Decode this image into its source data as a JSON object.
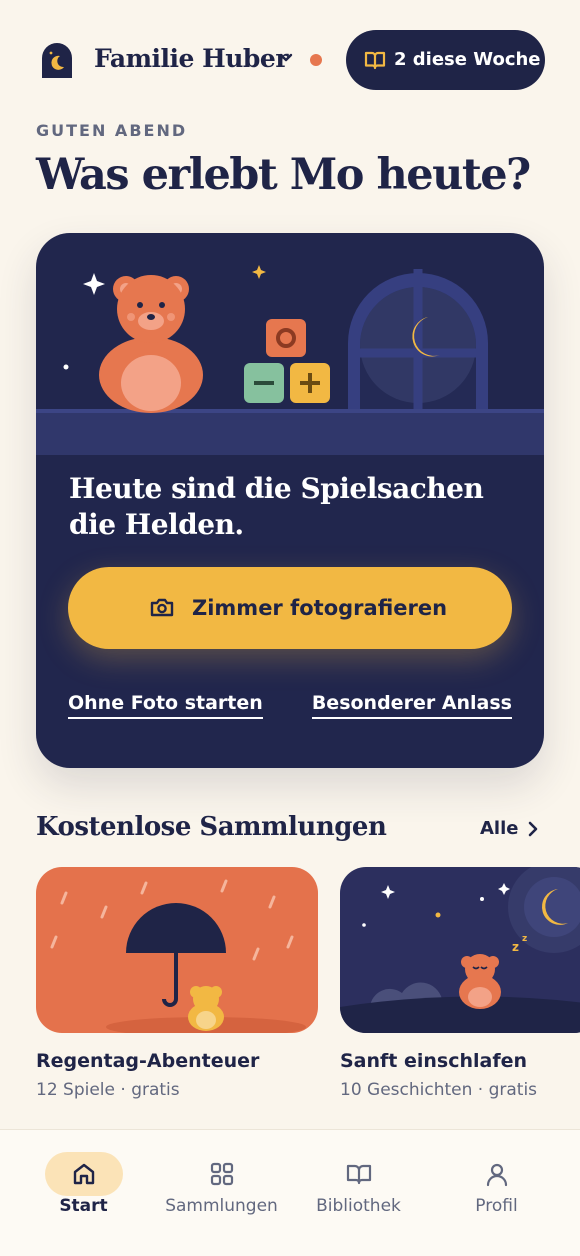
{
  "header": {
    "family_name": "Familie Huber",
    "icons": [
      "family-moon-icon",
      "chevron-down-icon",
      "notification-dot",
      "book-icon"
    ],
    "week_badge": "2 diese Woche"
  },
  "greeting": "GUTEN ABEND",
  "headline": "Was erlebt Mo heute?",
  "hero": {
    "text": "Heute sind die Spielsachen die Helden.",
    "primary_button": "Zimmer fotografieren",
    "link_left": "Ohne Foto starten",
    "link_right": "Besonderer Anlass"
  },
  "collections": {
    "title": "Kostenlose Sammlungen",
    "all_label": "Alle",
    "items": [
      {
        "title": "Regentag-Abenteuer",
        "subtitle": "12 Spiele · gratis"
      },
      {
        "title": "Sanft einschlafen",
        "subtitle": "10 Geschichten · gratis"
      }
    ]
  },
  "tabs": [
    {
      "label": "Start",
      "icon": "home-icon",
      "active": true
    },
    {
      "label": "Sammlungen",
      "icon": "grid-icon",
      "active": false
    },
    {
      "label": "Bibliothek",
      "icon": "book-icon",
      "active": false
    },
    {
      "label": "Profil",
      "icon": "user-icon",
      "active": false
    }
  ],
  "colors": {
    "background": "#faf5ec",
    "navy": "#1f2447",
    "accent_yellow": "#f2b843",
    "accent_orange": "#e6774f"
  }
}
